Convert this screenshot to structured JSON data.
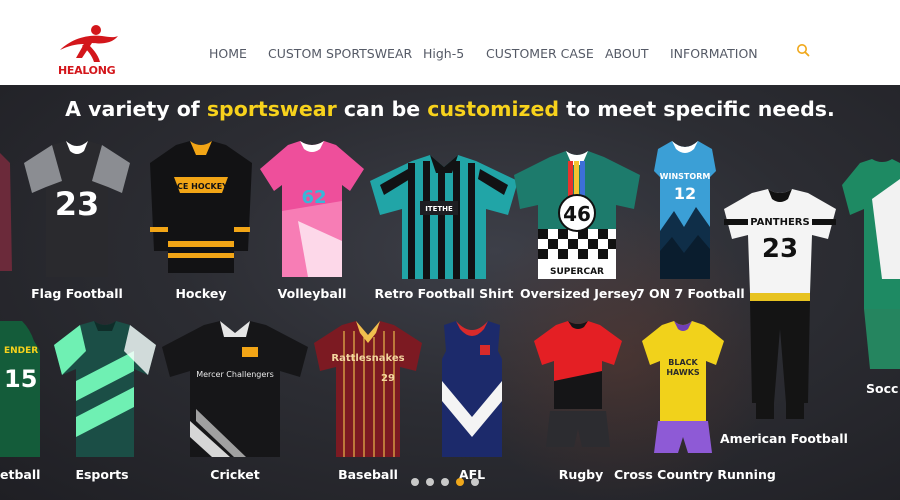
{
  "brand": {
    "name": "HEALONG",
    "logo_color": "#d3161b"
  },
  "nav": {
    "items": [
      "HOME",
      "CUSTOM SPORTSWEAR",
      "High-5",
      "CUSTOMER CASE",
      "ABOUT",
      "INFORMATION"
    ],
    "search_icon": "search-icon",
    "accent": "#f0a81b"
  },
  "banner": {
    "headline_parts": [
      "A variety of ",
      "sportswear",
      " can be ",
      "customized",
      " to meet specific needs."
    ],
    "highlight_color": "#f7d21c",
    "row1": [
      "Flag Football",
      "Hockey",
      "Volleyball",
      "Retro Football Shirt",
      "Oversized Jersey",
      "7 ON 7 Football"
    ],
    "row2": [
      "etball",
      "Esports",
      "Cricket",
      "Baseball",
      "AFL",
      "Rugby",
      "Cross Country Running"
    ],
    "right_labels": [
      "American Football",
      "Socc"
    ],
    "jersey_text": {
      "flag": "23",
      "hockey": "ICE HOCKEY",
      "volleyball": "62",
      "oversized": "46",
      "supercar": "SUPERCAR",
      "winstorm": "WINSTORM",
      "winstorm_num": "12",
      "panthers": "PANTHERS",
      "panthers_num": "23",
      "cricket": "Mercer Challengers",
      "baseball": "Rattlesnakes",
      "baseball_num": "29",
      "blackhawks": "BLACK HAWKS",
      "left_partial": "15",
      "left_partial_text": "ENDER"
    },
    "slider": {
      "dot_count": 5,
      "active_index": 3
    }
  }
}
